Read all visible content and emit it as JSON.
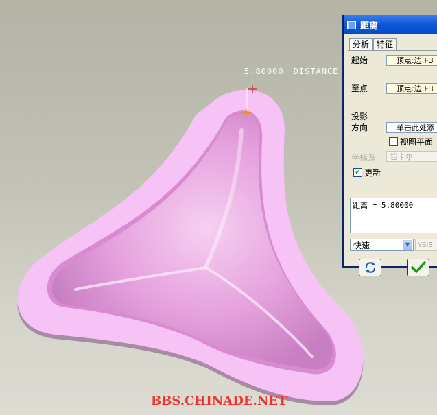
{
  "viewport": {
    "dimension_value": "5.80000",
    "dimension_name": "DISTANCE",
    "watermark": "BBS.CHINADE.NET"
  },
  "dialog": {
    "title": "距离",
    "tabs": [
      {
        "label": "分析",
        "active": true
      },
      {
        "label": "特征",
        "active": false
      }
    ],
    "from_label": "起始",
    "from_value": "顶点:边:F3",
    "to_label": "至点",
    "to_value": "顶点:边:F3",
    "projection_label_1": "投影",
    "projection_label_2": "方向",
    "projection_value": "单击此处添",
    "view_plane_label": "视图平面",
    "view_plane_checked": false,
    "csys_label": "坐标系",
    "csys_value": "笛卡尔",
    "update_label": "更新",
    "update_checked": true,
    "result_text": "距离 = 5.80000",
    "mode_value": "快速",
    "analysis_name": "YSIS_"
  },
  "colors": {
    "titlebar": "#0a58d8",
    "part_outer": "#f7c3f7",
    "part_inner": "#e69ae0",
    "watermark": "#ee3333"
  },
  "icons": {
    "repaint": "repaint-icon",
    "ok": "checkmark-icon"
  }
}
